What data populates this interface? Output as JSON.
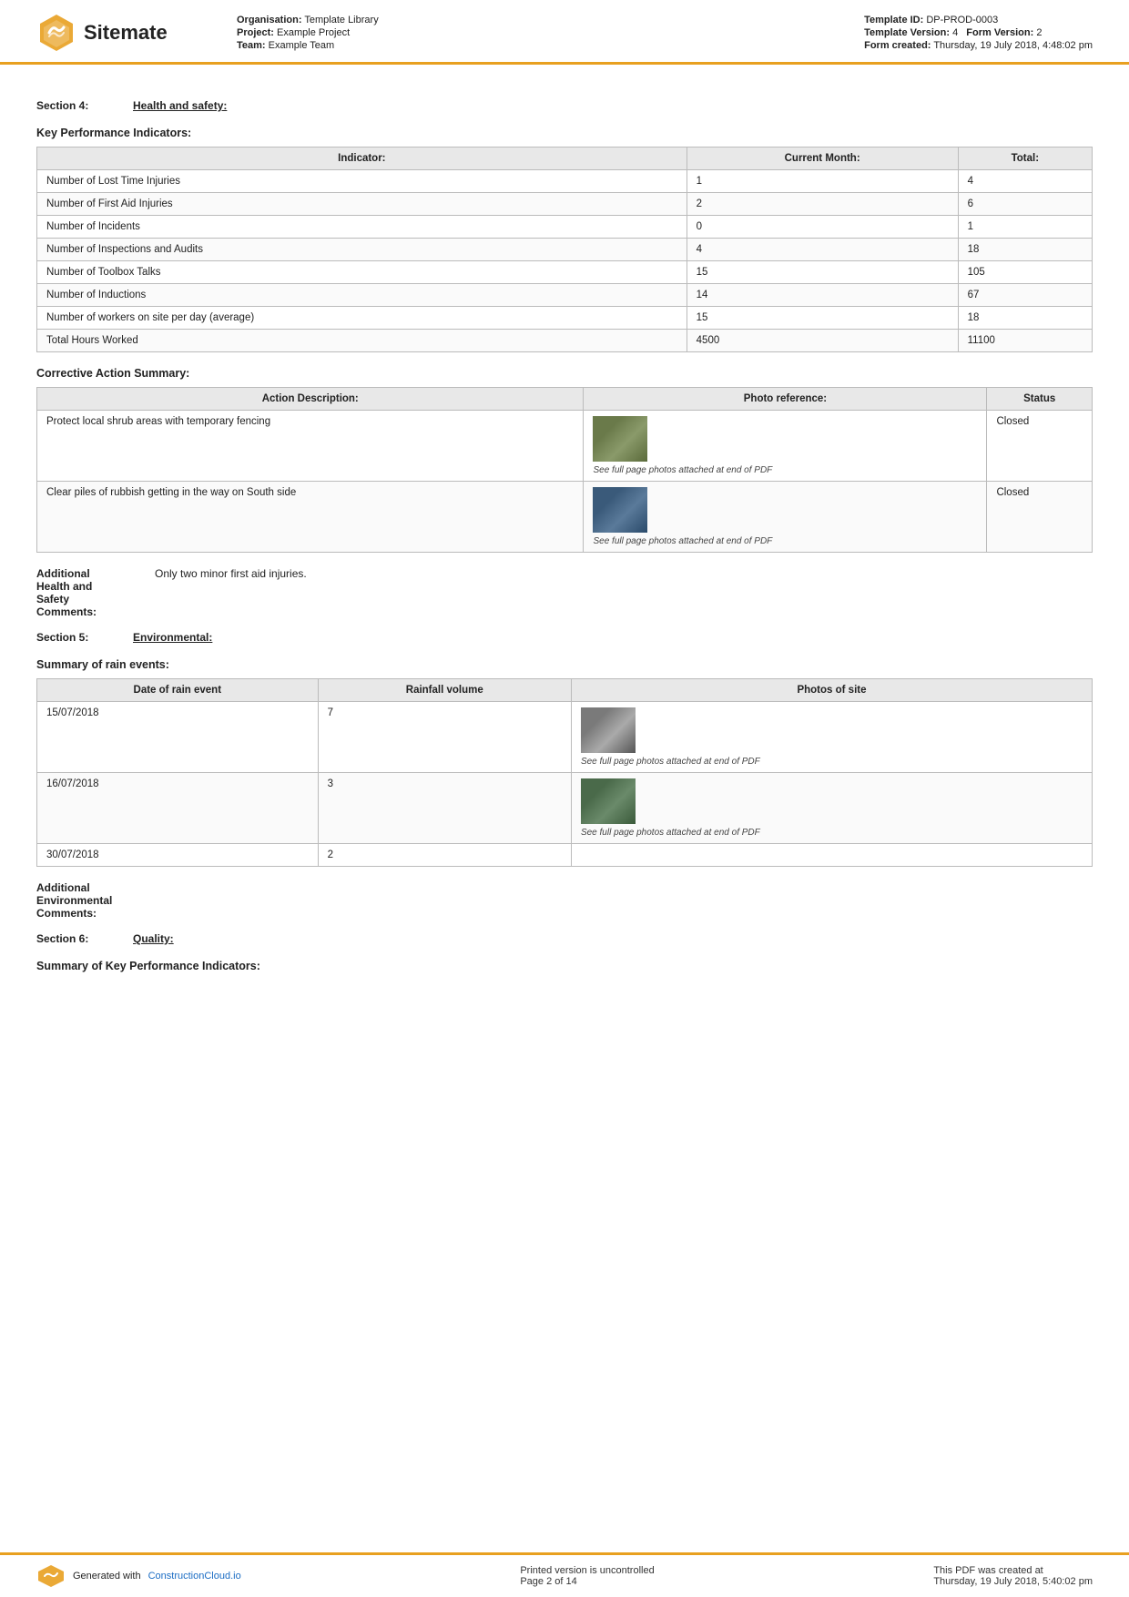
{
  "header": {
    "logo_text": "Sitemate",
    "org_label": "Organisation:",
    "org_value": "Template Library",
    "project_label": "Project:",
    "project_value": "Example Project",
    "team_label": "Team:",
    "team_value": "Example Team",
    "template_id_label": "Template ID:",
    "template_id_value": "DP-PROD-0003",
    "template_version_label": "Template Version:",
    "template_version_value": "4",
    "form_version_label": "Form Version:",
    "form_version_value": "2",
    "form_created_label": "Form created:",
    "form_created_value": "Thursday, 19 July 2018, 4:48:02 pm"
  },
  "section4": {
    "label": "Section 4:",
    "title": "Health and safety:"
  },
  "kpi": {
    "heading": "Key Performance Indicators:",
    "columns": [
      "Indicator:",
      "Current Month:",
      "Total:"
    ],
    "rows": [
      [
        "Number of Lost Time Injuries",
        "1",
        "4"
      ],
      [
        "Number of First Aid Injuries",
        "2",
        "6"
      ],
      [
        "Number of Incidents",
        "0",
        "1"
      ],
      [
        "Number of Inspections and Audits",
        "4",
        "18"
      ],
      [
        "Number of Toolbox Talks",
        "15",
        "105"
      ],
      [
        "Number of Inductions",
        "14",
        "67"
      ],
      [
        "Number of workers on site per day (average)",
        "15",
        "18"
      ],
      [
        "Total Hours Worked",
        "4500",
        "11100"
      ]
    ]
  },
  "corrective": {
    "heading": "Corrective Action Summary:",
    "columns": [
      "Action Description:",
      "Photo reference:",
      "Status"
    ],
    "rows": [
      {
        "description": "Protect local shrub areas with temporary fencing",
        "photo_caption": "See full page photos attached at end of PDF",
        "status": "Closed",
        "photo_type": "shrub"
      },
      {
        "description": "Clear piles of rubbish getting in the way on South side",
        "photo_caption": "See full page photos attached at end of PDF",
        "status": "Closed",
        "photo_type": "rubbish"
      }
    ]
  },
  "health_comments": {
    "label": "Additional\nHealth and\nSafety\nComments:",
    "label_line1": "Additional",
    "label_line2": "Health and",
    "label_line3": "Safety",
    "label_line4": "Comments:",
    "value": "Only two minor first aid injuries."
  },
  "section5": {
    "label": "Section 5:",
    "title": "Environmental:"
  },
  "rain": {
    "heading": "Summary of rain events:",
    "columns": [
      "Date of rain event",
      "Rainfall volume",
      "Photos of site"
    ],
    "rows": [
      {
        "date": "15/07/2018",
        "volume": "7",
        "photo_caption": "See full page photos attached at end of PDF",
        "photo_type": "rain1"
      },
      {
        "date": "16/07/2018",
        "volume": "3",
        "photo_caption": "See full page photos attached at end of PDF",
        "photo_type": "rain2"
      },
      {
        "date": "30/07/2018",
        "volume": "2",
        "photo_caption": "",
        "photo_type": ""
      }
    ]
  },
  "env_comments": {
    "label_line1": "Additional",
    "label_line2": "Environmental",
    "label_line3": "Comments:",
    "value": ""
  },
  "section6": {
    "label": "Section 6:",
    "title": "Quality:"
  },
  "quality": {
    "heading": "Summary of Key Performance Indicators:"
  },
  "footer": {
    "generated_label": "Generated with",
    "link_text": "ConstructionCloud.io",
    "center_line1": "Printed version is uncontrolled",
    "center_line2": "Page 2 of 14",
    "right_line1": "This PDF was created at",
    "right_line2": "Thursday, 19 July 2018, 5:40:02 pm"
  }
}
